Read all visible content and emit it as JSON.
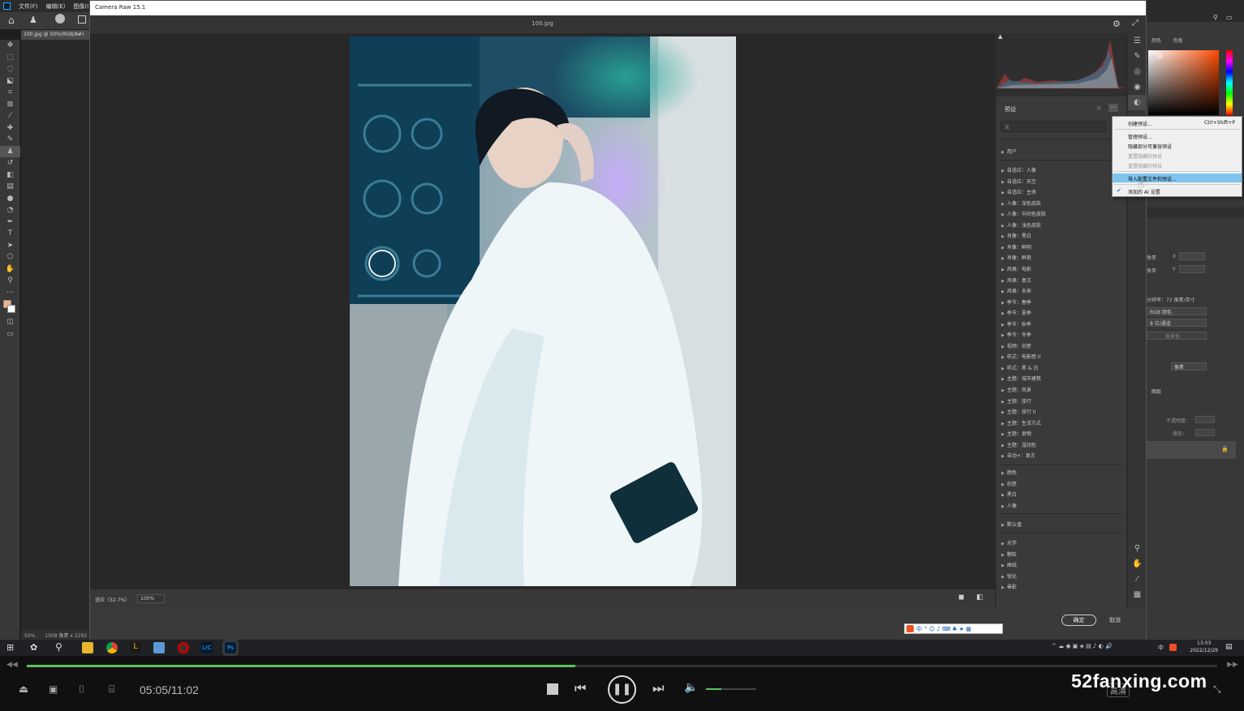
{
  "ps": {
    "menu": [
      "文件(F)",
      "编辑(E)",
      "图像(I)"
    ],
    "doc_tab": "100.jpg @ 50%(RGB/8#)",
    "status_zoom": "50%",
    "status_size": "1508 像素 x 2293",
    "right_tabs": [
      "颜色",
      "色板"
    ],
    "layers_tab": "图层",
    "prop_rows": [
      "像素",
      "像素"
    ],
    "prop_x": "X",
    "prop_y": "Y",
    "resolution": "分辨率：72 像素/英寸",
    "mode_select": "RGB 颜色",
    "bit_select": "8 位/通道",
    "bg_label": "背景色",
    "unit_select": "像素",
    "opacity_label": "不透明度：",
    "fill_label": "填充："
  },
  "cr": {
    "title": "Camera Raw 15.1",
    "filename": "100.jpg",
    "zoom_fit": "适应（32.7%）",
    "zoom_100": "100%",
    "ok": "确定",
    "cancel": "取消",
    "presets_title": "预设",
    "search_placeholder": "无",
    "group_user": "用户",
    "presets": [
      "自适应：人像",
      "自适应：天空",
      "自适应：主体",
      "人像：深色皮肤",
      "人像：中间色皮肤",
      "人像：浅色皮肤",
      "肖像：黑白",
      "肖像：鲜明",
      "肖像：鲜艳",
      "风格：电影",
      "风格：复古",
      "风格：未来",
      "季节：春季",
      "季节：夏季",
      "季节：秋季",
      "季节：冬季",
      "视频：创意",
      "样式：电影感 II",
      "样式：黑 & 白",
      "主题：城市建筑",
      "主题：风景",
      "主题：旅行",
      "主题：旅行 II",
      "主题：生活方式",
      "主题：食物",
      "主题：湿润色",
      "自动+：复古"
    ],
    "presets_b": [
      "颜色",
      "创意",
      "黑白",
      "人像"
    ],
    "preset_default": "默认值",
    "presets_c": [
      "光学",
      "颗粒",
      "曲线",
      "锐化",
      "晕影"
    ]
  },
  "menu": {
    "items": [
      {
        "label": "创建预设...",
        "shortcut": "Ctrl+Shift+P"
      },
      {
        "label": "管理预设..."
      },
      {
        "label": "隐藏部分可兼容预设"
      },
      {
        "label": "重置隐藏的预设"
      },
      {
        "label": "重置隐藏的预设"
      },
      {
        "label": "导入配置文件和预设..."
      },
      {
        "label": "添加的 AI 设置"
      }
    ]
  },
  "taskbar": {
    "time": "13:03",
    "date": "2022/12/29",
    "ime": "中",
    "ime_mode": "中"
  },
  "player": {
    "progress": 0.461,
    "time": "05:05/11:02",
    "watermark": "52fanxing.com",
    "volume": 0.3,
    "hd_label": "高清"
  },
  "colors": {
    "progress": "#5ec15e",
    "menu_highlight": "#7ec4ee",
    "ps_highlight": "#2b6fb8"
  }
}
